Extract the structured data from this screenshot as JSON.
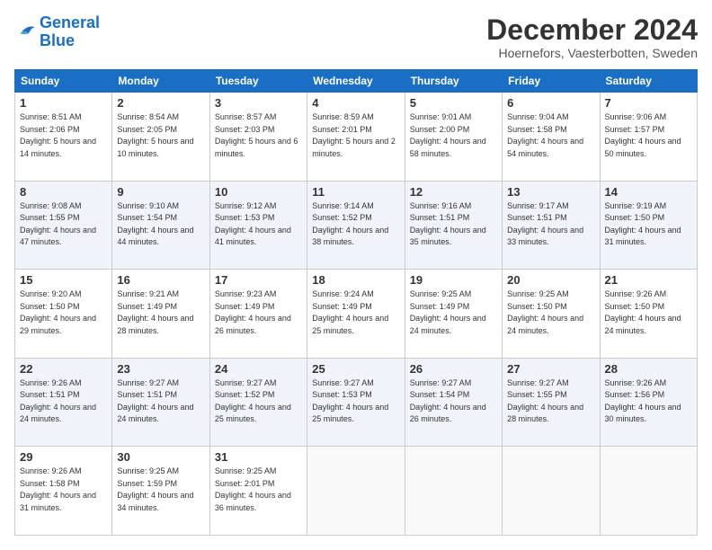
{
  "header": {
    "logo_line1": "General",
    "logo_line2": "Blue",
    "main_title": "December 2024",
    "subtitle": "Hoernefors, Vaesterbotten, Sweden"
  },
  "days_of_week": [
    "Sunday",
    "Monday",
    "Tuesday",
    "Wednesday",
    "Thursday",
    "Friday",
    "Saturday"
  ],
  "weeks": [
    [
      {
        "day": 1,
        "sunrise": "8:51 AM",
        "sunset": "2:06 PM",
        "daylight": "5 hours and 14 minutes."
      },
      {
        "day": 2,
        "sunrise": "8:54 AM",
        "sunset": "2:05 PM",
        "daylight": "5 hours and 10 minutes."
      },
      {
        "day": 3,
        "sunrise": "8:57 AM",
        "sunset": "2:03 PM",
        "daylight": "5 hours and 6 minutes."
      },
      {
        "day": 4,
        "sunrise": "8:59 AM",
        "sunset": "2:01 PM",
        "daylight": "5 hours and 2 minutes."
      },
      {
        "day": 5,
        "sunrise": "9:01 AM",
        "sunset": "2:00 PM",
        "daylight": "4 hours and 58 minutes."
      },
      {
        "day": 6,
        "sunrise": "9:04 AM",
        "sunset": "1:58 PM",
        "daylight": "4 hours and 54 minutes."
      },
      {
        "day": 7,
        "sunrise": "9:06 AM",
        "sunset": "1:57 PM",
        "daylight": "4 hours and 50 minutes."
      }
    ],
    [
      {
        "day": 8,
        "sunrise": "9:08 AM",
        "sunset": "1:55 PM",
        "daylight": "4 hours and 47 minutes."
      },
      {
        "day": 9,
        "sunrise": "9:10 AM",
        "sunset": "1:54 PM",
        "daylight": "4 hours and 44 minutes."
      },
      {
        "day": 10,
        "sunrise": "9:12 AM",
        "sunset": "1:53 PM",
        "daylight": "4 hours and 41 minutes."
      },
      {
        "day": 11,
        "sunrise": "9:14 AM",
        "sunset": "1:52 PM",
        "daylight": "4 hours and 38 minutes."
      },
      {
        "day": 12,
        "sunrise": "9:16 AM",
        "sunset": "1:51 PM",
        "daylight": "4 hours and 35 minutes."
      },
      {
        "day": 13,
        "sunrise": "9:17 AM",
        "sunset": "1:51 PM",
        "daylight": "4 hours and 33 minutes."
      },
      {
        "day": 14,
        "sunrise": "9:19 AM",
        "sunset": "1:50 PM",
        "daylight": "4 hours and 31 minutes."
      }
    ],
    [
      {
        "day": 15,
        "sunrise": "9:20 AM",
        "sunset": "1:50 PM",
        "daylight": "4 hours and 29 minutes."
      },
      {
        "day": 16,
        "sunrise": "9:21 AM",
        "sunset": "1:49 PM",
        "daylight": "4 hours and 28 minutes."
      },
      {
        "day": 17,
        "sunrise": "9:23 AM",
        "sunset": "1:49 PM",
        "daylight": "4 hours and 26 minutes."
      },
      {
        "day": 18,
        "sunrise": "9:24 AM",
        "sunset": "1:49 PM",
        "daylight": "4 hours and 25 minutes."
      },
      {
        "day": 19,
        "sunrise": "9:25 AM",
        "sunset": "1:49 PM",
        "daylight": "4 hours and 24 minutes."
      },
      {
        "day": 20,
        "sunrise": "9:25 AM",
        "sunset": "1:50 PM",
        "daylight": "4 hours and 24 minutes."
      },
      {
        "day": 21,
        "sunrise": "9:26 AM",
        "sunset": "1:50 PM",
        "daylight": "4 hours and 24 minutes."
      }
    ],
    [
      {
        "day": 22,
        "sunrise": "9:26 AM",
        "sunset": "1:51 PM",
        "daylight": "4 hours and 24 minutes."
      },
      {
        "day": 23,
        "sunrise": "9:27 AM",
        "sunset": "1:51 PM",
        "daylight": "4 hours and 24 minutes."
      },
      {
        "day": 24,
        "sunrise": "9:27 AM",
        "sunset": "1:52 PM",
        "daylight": "4 hours and 25 minutes."
      },
      {
        "day": 25,
        "sunrise": "9:27 AM",
        "sunset": "1:53 PM",
        "daylight": "4 hours and 25 minutes."
      },
      {
        "day": 26,
        "sunrise": "9:27 AM",
        "sunset": "1:54 PM",
        "daylight": "4 hours and 26 minutes."
      },
      {
        "day": 27,
        "sunrise": "9:27 AM",
        "sunset": "1:55 PM",
        "daylight": "4 hours and 28 minutes."
      },
      {
        "day": 28,
        "sunrise": "9:26 AM",
        "sunset": "1:56 PM",
        "daylight": "4 hours and 30 minutes."
      }
    ],
    [
      {
        "day": 29,
        "sunrise": "9:26 AM",
        "sunset": "1:58 PM",
        "daylight": "4 hours and 31 minutes."
      },
      {
        "day": 30,
        "sunrise": "9:25 AM",
        "sunset": "1:59 PM",
        "daylight": "4 hours and 34 minutes."
      },
      {
        "day": 31,
        "sunrise": "9:25 AM",
        "sunset": "2:01 PM",
        "daylight": "4 hours and 36 minutes."
      },
      null,
      null,
      null,
      null
    ]
  ]
}
